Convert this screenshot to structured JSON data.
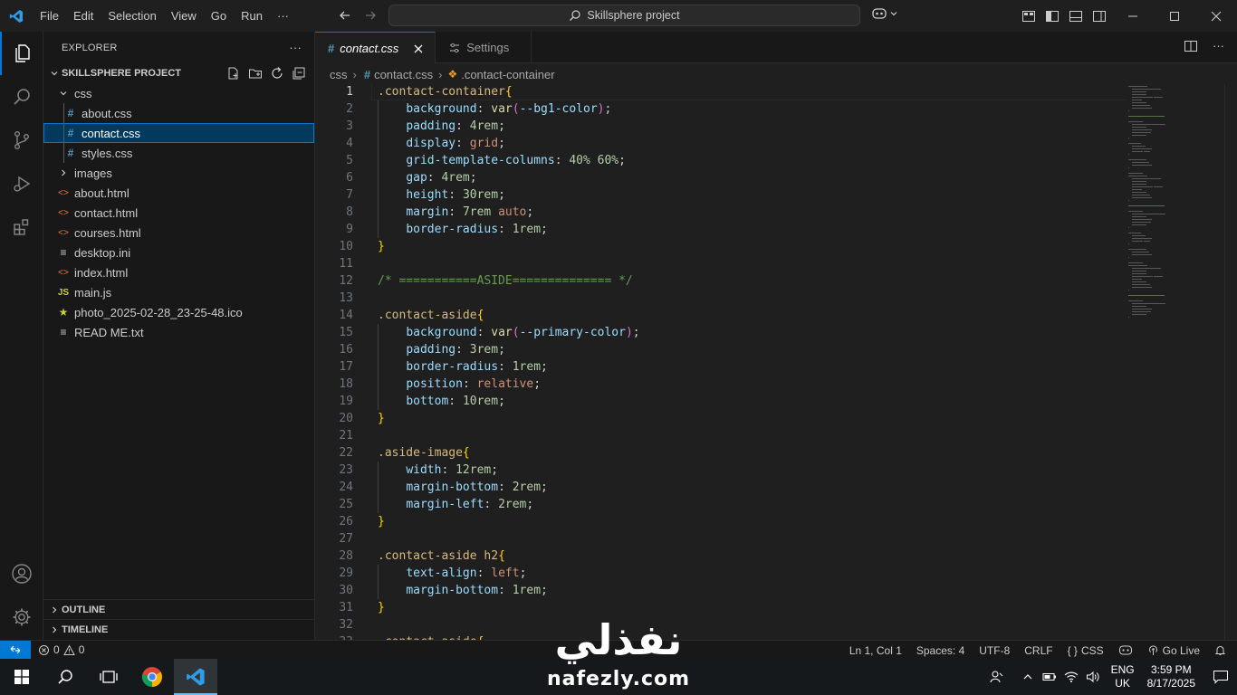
{
  "titlebar": {
    "menu": [
      "File",
      "Edit",
      "Selection",
      "View",
      "Go",
      "Run",
      "···"
    ],
    "search_text": "Skillsphere project"
  },
  "explorer": {
    "title": "EXPLORER",
    "more": "···",
    "project": "SKILLSPHERE PROJECT",
    "tree": [
      {
        "label": "css",
        "kind": "folder-open",
        "depth": 1
      },
      {
        "label": "about.css",
        "kind": "css",
        "depth": 2
      },
      {
        "label": "contact.css",
        "kind": "css",
        "depth": 2,
        "selected": true
      },
      {
        "label": "styles.css",
        "kind": "css",
        "depth": 2
      },
      {
        "label": "images",
        "kind": "folder",
        "depth": 1
      },
      {
        "label": "about.html",
        "kind": "html",
        "depth": 1
      },
      {
        "label": "contact.html",
        "kind": "html",
        "depth": 1
      },
      {
        "label": "courses.html",
        "kind": "html",
        "depth": 1
      },
      {
        "label": "desktop.ini",
        "kind": "text",
        "depth": 1
      },
      {
        "label": "index.html",
        "kind": "html",
        "depth": 1
      },
      {
        "label": "main.js",
        "kind": "js",
        "depth": 1
      },
      {
        "label": "photo_2025-02-28_23-25-48.ico",
        "kind": "ico",
        "depth": 1
      },
      {
        "label": "READ ME.txt",
        "kind": "text",
        "depth": 1
      }
    ],
    "outline": "OUTLINE",
    "timeline": "TIMELINE"
  },
  "tabs": [
    {
      "label": "contact.css",
      "active": true,
      "icon": "#"
    },
    {
      "label": "Settings",
      "active": false
    }
  ],
  "breadcrumb": {
    "folder": "css",
    "file": "contact.css",
    "symbol": ".contact-container"
  },
  "code": [
    [
      [
        "sel",
        ".contact-container"
      ],
      [
        "brace",
        "{"
      ]
    ],
    [
      [
        "ws",
        "    "
      ],
      [
        "prop",
        "background"
      ],
      [
        "punc",
        ": "
      ],
      [
        "fn",
        "var"
      ],
      [
        "paren",
        "("
      ],
      [
        "var",
        "--bg1-color"
      ],
      [
        "paren",
        ")"
      ],
      [
        "punc",
        ";"
      ]
    ],
    [
      [
        "ws",
        "    "
      ],
      [
        "prop",
        "padding"
      ],
      [
        "punc",
        ": "
      ],
      [
        "num",
        "4rem"
      ],
      [
        "punc",
        ";"
      ]
    ],
    [
      [
        "ws",
        "    "
      ],
      [
        "prop",
        "display"
      ],
      [
        "punc",
        ": "
      ],
      [
        "kw",
        "grid"
      ],
      [
        "punc",
        ";"
      ]
    ],
    [
      [
        "ws",
        "    "
      ],
      [
        "prop",
        "grid-template-columns"
      ],
      [
        "punc",
        ": "
      ],
      [
        "num",
        "40%"
      ],
      [
        "punc",
        " "
      ],
      [
        "num",
        "60%"
      ],
      [
        "punc",
        ";"
      ]
    ],
    [
      [
        "ws",
        "    "
      ],
      [
        "prop",
        "gap"
      ],
      [
        "punc",
        ": "
      ],
      [
        "num",
        "4rem"
      ],
      [
        "punc",
        ";"
      ]
    ],
    [
      [
        "ws",
        "    "
      ],
      [
        "prop",
        "height"
      ],
      [
        "punc",
        ": "
      ],
      [
        "num",
        "30rem"
      ],
      [
        "punc",
        ";"
      ]
    ],
    [
      [
        "ws",
        "    "
      ],
      [
        "prop",
        "margin"
      ],
      [
        "punc",
        ": "
      ],
      [
        "num",
        "7rem"
      ],
      [
        "punc",
        " "
      ],
      [
        "kw",
        "auto"
      ],
      [
        "punc",
        ";"
      ]
    ],
    [
      [
        "ws",
        "    "
      ],
      [
        "prop",
        "border-radius"
      ],
      [
        "punc",
        ": "
      ],
      [
        "num",
        "1rem"
      ],
      [
        "punc",
        ";"
      ]
    ],
    [
      [
        "brace",
        "}"
      ]
    ],
    [],
    [
      [
        "cm",
        "/* ===========ASIDE============== */"
      ]
    ],
    [],
    [
      [
        "sel",
        ".contact-aside"
      ],
      [
        "brace",
        "{"
      ]
    ],
    [
      [
        "ws",
        "    "
      ],
      [
        "prop",
        "background"
      ],
      [
        "punc",
        ": "
      ],
      [
        "fn",
        "var"
      ],
      [
        "paren",
        "("
      ],
      [
        "var",
        "--primary-color"
      ],
      [
        "paren",
        ")"
      ],
      [
        "punc",
        ";"
      ]
    ],
    [
      [
        "ws",
        "    "
      ],
      [
        "prop",
        "padding"
      ],
      [
        "punc",
        ": "
      ],
      [
        "num",
        "3rem"
      ],
      [
        "punc",
        ";"
      ]
    ],
    [
      [
        "ws",
        "    "
      ],
      [
        "prop",
        "border-radius"
      ],
      [
        "punc",
        ": "
      ],
      [
        "num",
        "1rem"
      ],
      [
        "punc",
        ";"
      ]
    ],
    [
      [
        "ws",
        "    "
      ],
      [
        "prop",
        "position"
      ],
      [
        "punc",
        ": "
      ],
      [
        "kw",
        "relative"
      ],
      [
        "punc",
        ";"
      ]
    ],
    [
      [
        "ws",
        "    "
      ],
      [
        "prop",
        "bottom"
      ],
      [
        "punc",
        ": "
      ],
      [
        "num",
        "10rem"
      ],
      [
        "punc",
        ";"
      ]
    ],
    [
      [
        "brace",
        "}"
      ]
    ],
    [],
    [
      [
        "sel",
        ".aside-image"
      ],
      [
        "brace",
        "{"
      ]
    ],
    [
      [
        "ws",
        "    "
      ],
      [
        "prop",
        "width"
      ],
      [
        "punc",
        ": "
      ],
      [
        "num",
        "12rem"
      ],
      [
        "punc",
        ";"
      ]
    ],
    [
      [
        "ws",
        "    "
      ],
      [
        "prop",
        "margin-bottom"
      ],
      [
        "punc",
        ": "
      ],
      [
        "num",
        "2rem"
      ],
      [
        "punc",
        ";"
      ]
    ],
    [
      [
        "ws",
        "    "
      ],
      [
        "prop",
        "margin-left"
      ],
      [
        "punc",
        ": "
      ],
      [
        "num",
        "2rem"
      ],
      [
        "punc",
        ";"
      ]
    ],
    [
      [
        "brace",
        "}"
      ]
    ],
    [],
    [
      [
        "sel",
        ".contact-aside h2"
      ],
      [
        "brace",
        "{"
      ]
    ],
    [
      [
        "ws",
        "    "
      ],
      [
        "prop",
        "text-align"
      ],
      [
        "punc",
        ": "
      ],
      [
        "kw",
        "left"
      ],
      [
        "punc",
        ";"
      ]
    ],
    [
      [
        "ws",
        "    "
      ],
      [
        "prop",
        "margin-bottom"
      ],
      [
        "punc",
        ": "
      ],
      [
        "num",
        "1rem"
      ],
      [
        "punc",
        ";"
      ]
    ],
    [
      [
        "brace",
        "}"
      ]
    ],
    [],
    [
      [
        "sel",
        ".contact-aside"
      ],
      [
        "brace",
        "{"
      ]
    ]
  ],
  "current_line": 1,
  "statusbar": {
    "errors": "0",
    "warnings": "0",
    "position": "Ln 1, Col 1",
    "spaces": "Spaces: 4",
    "encoding": "UTF-8",
    "eol": "CRLF",
    "language": "CSS",
    "golive": "Go Live"
  },
  "taskbar": {
    "lang_top": "ENG",
    "lang_bottom": "UK",
    "time": "3:59 PM",
    "date": "8/17/2025"
  },
  "watermark": {
    "arabic": "نفذلي",
    "latin": "nafezly.com"
  },
  "colors": {
    "accent": "#0078d4",
    "selected_row": "#04395e"
  }
}
